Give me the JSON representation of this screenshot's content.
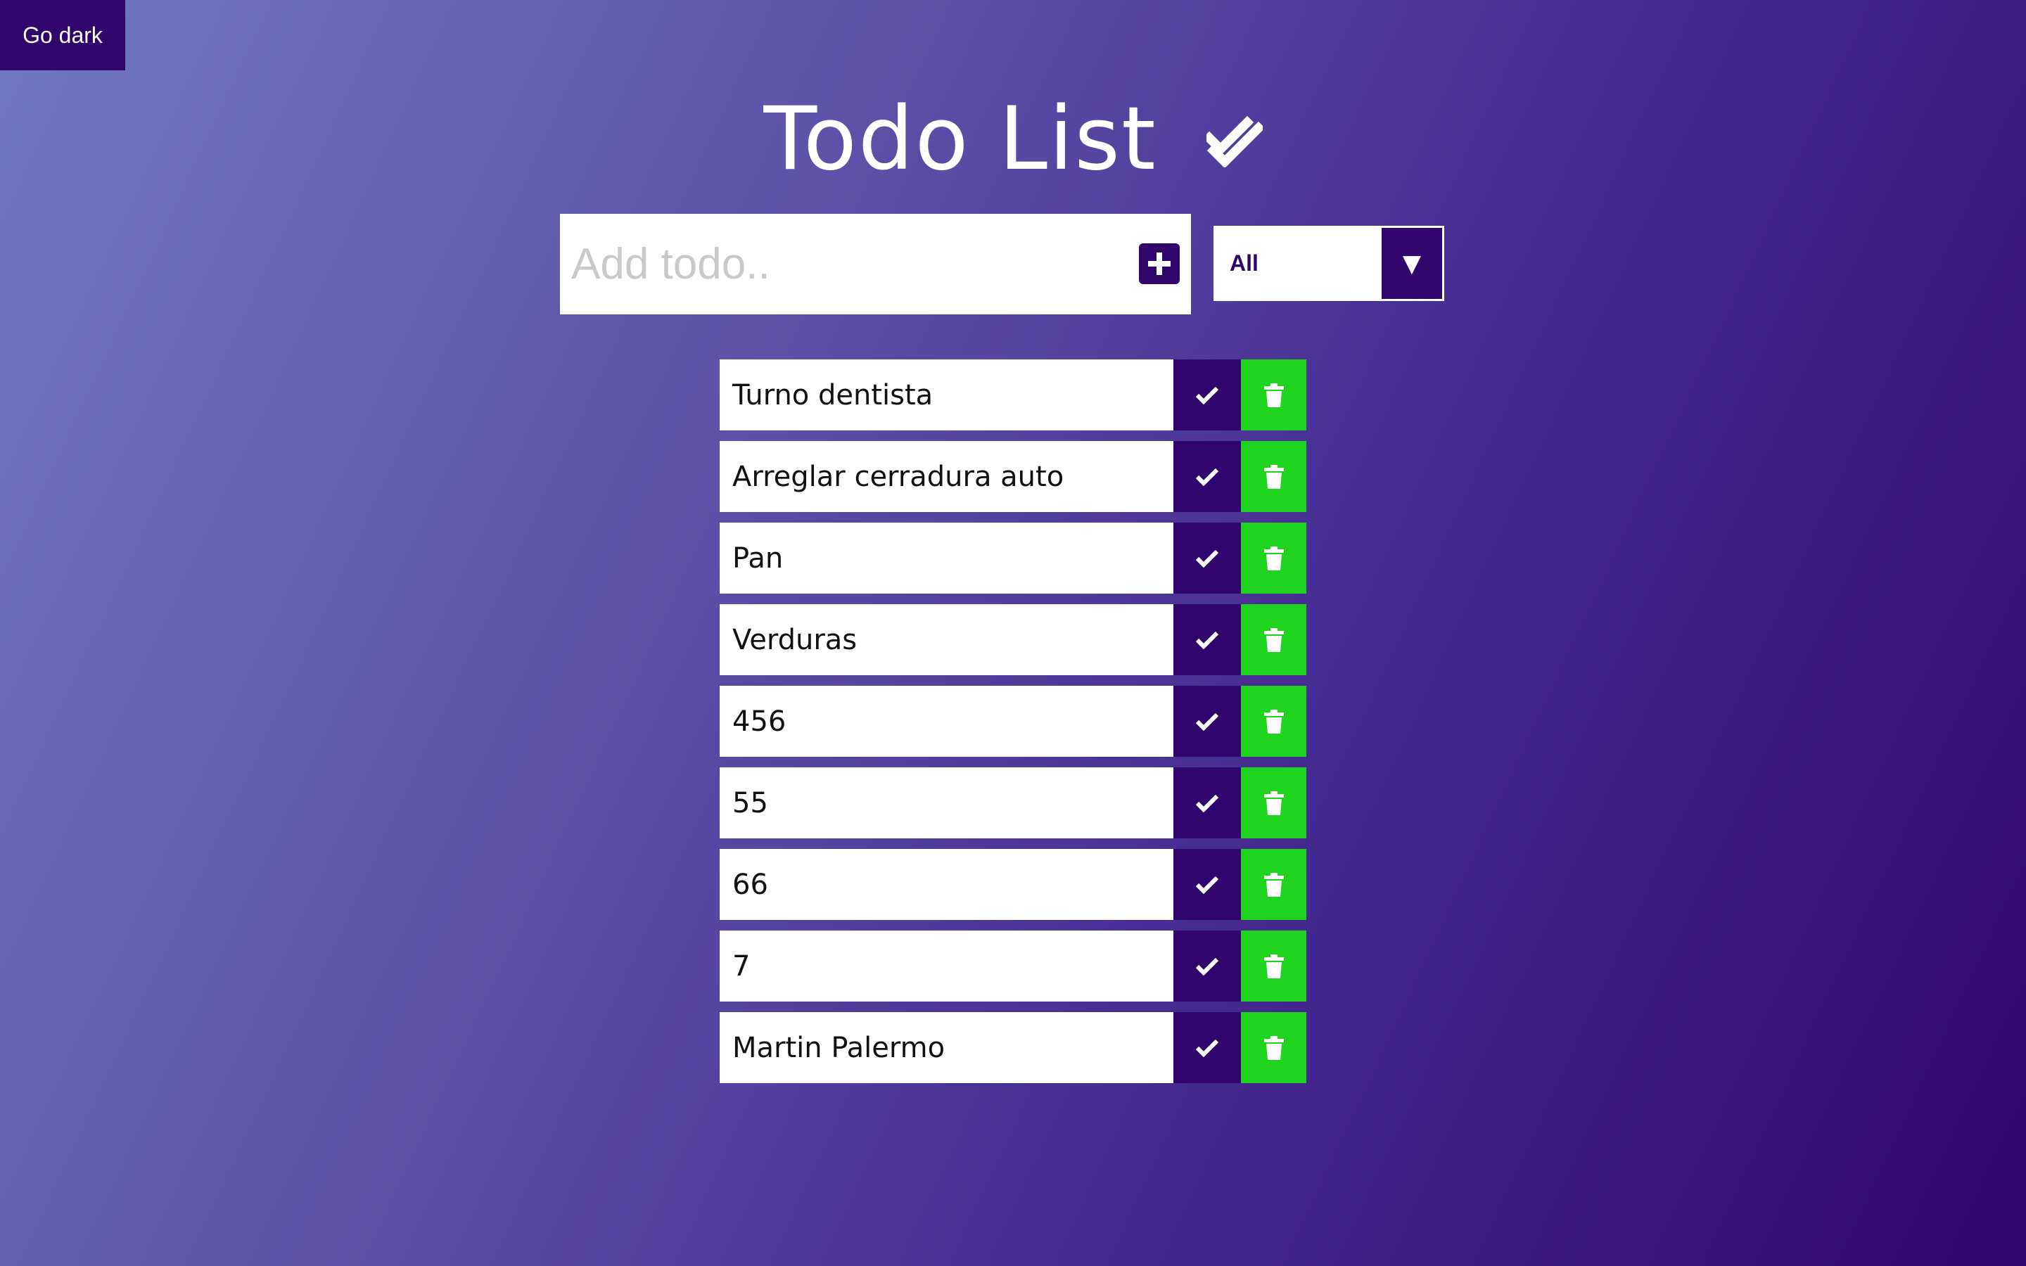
{
  "header": {
    "theme_toggle_label": "Go dark",
    "title": "Todo List",
    "title_icon": "double-check-icon"
  },
  "add_form": {
    "placeholder": "Add todo..",
    "value": "",
    "add_icon": "plus-square-icon"
  },
  "filter": {
    "selected": "All",
    "arrow_icon": "caret-down-icon"
  },
  "todos": [
    {
      "text": "Turno dentista"
    },
    {
      "text": "Arreglar cerradura auto"
    },
    {
      "text": "Pan"
    },
    {
      "text": "Verduras"
    },
    {
      "text": "456"
    },
    {
      "text": "55"
    },
    {
      "text": "66"
    },
    {
      "text": "7"
    },
    {
      "text": "Martin Palermo"
    }
  ],
  "item_icons": {
    "complete": "check-icon",
    "delete": "trash-icon"
  },
  "colors": {
    "primary": "#31066c",
    "delete": "#1fd41f",
    "background_start": "#7179c5",
    "background_end": "#31066c"
  }
}
